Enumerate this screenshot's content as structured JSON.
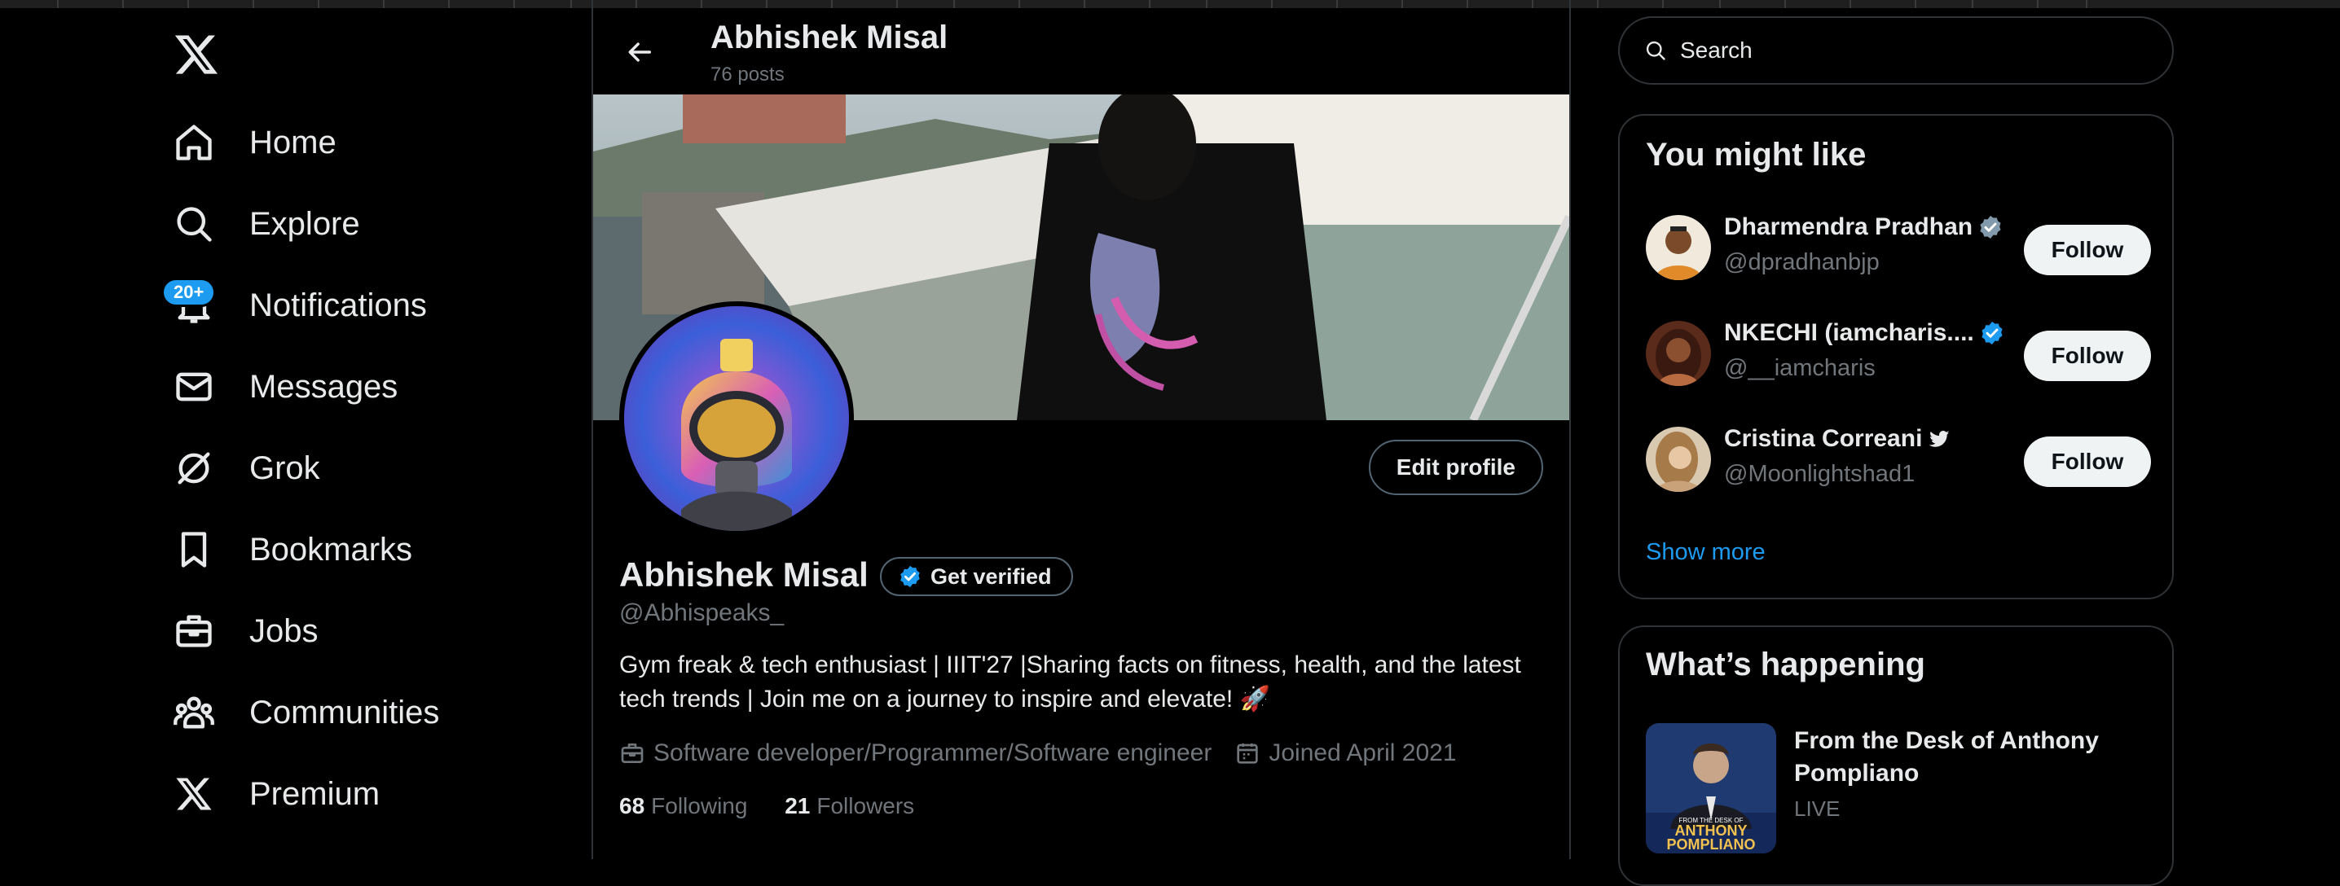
{
  "nav": {
    "items": [
      {
        "label": "Home"
      },
      {
        "label": "Explore"
      },
      {
        "label": "Notifications",
        "badge": "20+"
      },
      {
        "label": "Messages"
      },
      {
        "label": "Grok"
      },
      {
        "label": "Bookmarks"
      },
      {
        "label": "Jobs"
      },
      {
        "label": "Communities"
      },
      {
        "label": "Premium"
      }
    ]
  },
  "header": {
    "title": "Abhishek Misal",
    "posts": "76 posts"
  },
  "profile": {
    "edit_label": "Edit profile",
    "name": "Abhishek Misal",
    "get_verified": "Get verified",
    "handle": "@Abhispeaks_",
    "bio": "Gym freak & tech enthusiast | IIIT'27 |Sharing facts on fitness, health, and the latest tech trends | Join me on a journey to inspire and elevate! 🚀",
    "profession": "Software developer/Programmer/Software engineer",
    "joined": "Joined April 2021",
    "following_count": "68",
    "following_label": "Following",
    "followers_count": "21",
    "followers_label": "Followers"
  },
  "search": {
    "placeholder": "Search"
  },
  "suggestions": {
    "title": "You might like",
    "follow_label": "Follow",
    "items": [
      {
        "name": "Dharmendra Pradhan",
        "handle": "@dpradhanbjp"
      },
      {
        "name": "NKECHI (iamcharis....",
        "handle": "@__iamcharis"
      },
      {
        "name": "Cristina Correani",
        "handle": "@Moonlightshad1"
      }
    ],
    "show_more": "Show more"
  },
  "happening": {
    "title": "What’s happening",
    "items": [
      {
        "title": "From the Desk of Anthony Pompliano",
        "status": "LIVE",
        "thumb_line1": "ANTHONY",
        "thumb_line2": "POMPLIANO",
        "thumb_small": "FROM THE DESK OF"
      }
    ]
  },
  "colors": {
    "accent": "#1d9bf0",
    "background": "#000000",
    "text": "#e7e9ea",
    "muted": "#71767b",
    "border": "#2f3336"
  }
}
